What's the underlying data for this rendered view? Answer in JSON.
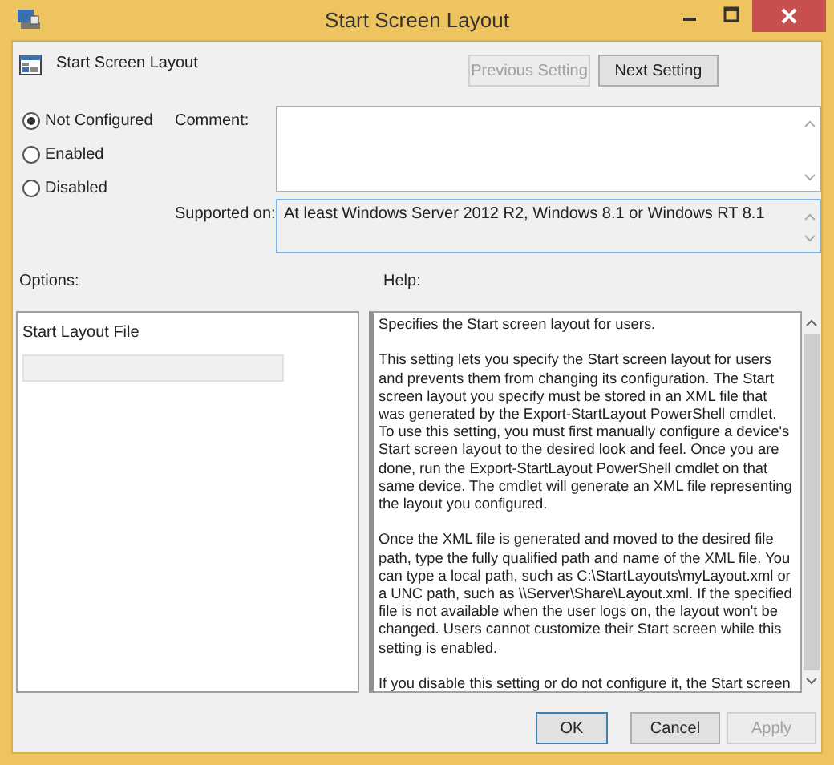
{
  "window": {
    "title": "Start Screen Layout"
  },
  "policy": {
    "title": "Start Screen Layout"
  },
  "nav_buttons": [
    {
      "label": "Previous Setting",
      "disabled": true
    },
    {
      "label": "Next Setting",
      "disabled": false
    }
  ],
  "states": [
    {
      "label": "Not Configured",
      "selected": true
    },
    {
      "label": "Enabled",
      "selected": false
    },
    {
      "label": "Disabled",
      "selected": false
    }
  ],
  "comment": {
    "label": "Comment:"
  },
  "supported_on": {
    "label": "Supported on:",
    "value": "At least Windows Server 2012 R2, Windows 8.1 or Windows RT 8.1"
  },
  "options": {
    "label": "Options:",
    "field_label": "Start Layout File",
    "field_disabled": true
  },
  "help": {
    "label": "Help:",
    "blocks": [
      [
        "Specifies the Start screen layout for users."
      ],
      [
        "This setting lets you specify the Start screen layout for users and prevents them from changing its configuration. The Start screen layout you specify must be stored in an XML file that was generated by the Export-StartLayout PowerShell cmdlet.",
        "To use this setting, you must first manually configure a device's Start screen layout to the desired look and feel. Once you are done, run the Export-StartLayout PowerShell cmdlet on that same device. The cmdlet will generate an XML file representing the layout you configured."
      ],
      [
        "Once the XML file is generated and moved to the desired file path, type the fully qualified path and name of the XML file. You can type a local path, such as C:\\StartLayouts\\myLayout.xml or a UNC path, such as \\\\Server\\Share\\Layout.xml. If the specified file is not available when the user logs on, the layout won't be changed. Users cannot customize their Start screen while this setting is enabled."
      ],
      [
        "If you disable this setting or do not configure it, the Start screen"
      ]
    ]
  },
  "buttons": [
    {
      "label": "OK",
      "default": true,
      "disabled": false
    },
    {
      "label": "Cancel",
      "default": false,
      "disabled": false
    },
    {
      "label": "Apply",
      "default": false,
      "disabled": true
    }
  ]
}
